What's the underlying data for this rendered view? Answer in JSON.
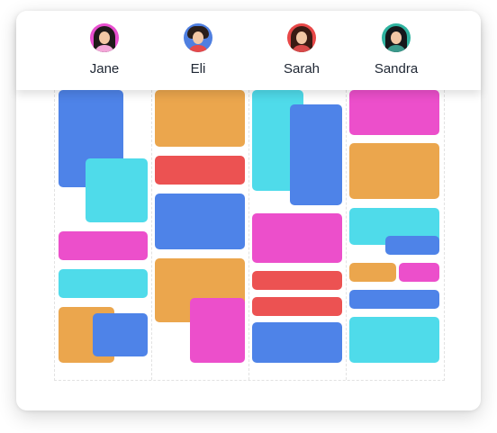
{
  "people": [
    {
      "name": "Jane",
      "avatar_icon": "avatar-jane-icon",
      "ring": "#e84fcf",
      "shirt": "#f3a6d8"
    },
    {
      "name": "Eli",
      "avatar_icon": "avatar-eli-icon",
      "ring": "#4f7fe0",
      "shirt": "#e44a4a"
    },
    {
      "name": "Sarah",
      "avatar_icon": "avatar-sarah-icon",
      "ring": "#e84848",
      "shirt": "#d84a4a"
    },
    {
      "name": "Sandra",
      "avatar_icon": "avatar-sandra-icon",
      "ring": "#2fb3a0",
      "shirt": "#3b9a8c"
    }
  ],
  "colors": {
    "blue": "#4e83e8",
    "cyan": "#4fdbea",
    "magenta": "#ec4fcb",
    "orange": "#eba64d",
    "red": "#ec5252"
  }
}
